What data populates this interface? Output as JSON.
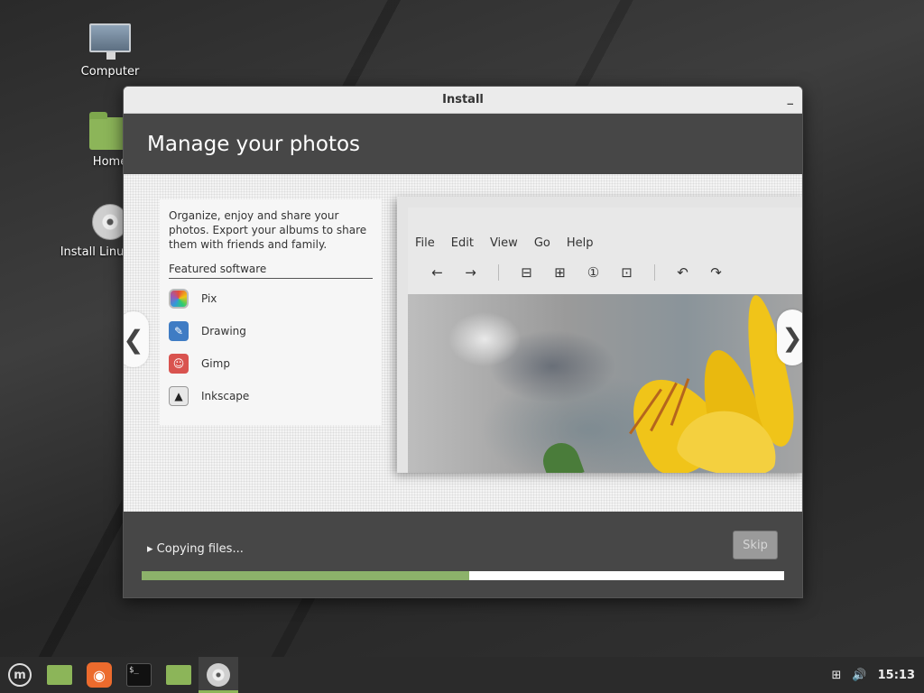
{
  "desktop": {
    "icons": [
      {
        "label": "Computer",
        "icon": "computer-icon"
      },
      {
        "label": "Home",
        "icon": "home-folder-icon"
      },
      {
        "label": "Install Linux Mint",
        "icon": "install-disc-icon"
      }
    ]
  },
  "window": {
    "title": "Install",
    "minimize_glyph": "_",
    "header": "Manage your photos",
    "description": "Organize, enjoy and share your photos. Export your albums to share them with friends and family.",
    "featured_title": "Featured software",
    "apps": [
      {
        "name": "Pix",
        "icon": "pix-icon"
      },
      {
        "name": "Drawing",
        "icon": "drawing-icon"
      },
      {
        "name": "Gimp",
        "icon": "gimp-icon"
      },
      {
        "name": "Inkscape",
        "icon": "inkscape-icon"
      }
    ],
    "nav_prev": "❮",
    "nav_next": "❯",
    "preview": {
      "menu": [
        "File",
        "Edit",
        "View",
        "Go",
        "Help"
      ],
      "toolbar": [
        "←",
        "→",
        "⊟",
        "⊞",
        "①",
        "⊡",
        "↶",
        "↷"
      ]
    },
    "status": "▸ Copying files...",
    "skip_label": "Skip",
    "progress": 0.51
  },
  "taskbar": {
    "clock": "15:13",
    "items": [
      "menu-icon",
      "files-icon",
      "firefox-icon",
      "terminal-icon",
      "folder-icon",
      "installer-icon"
    ],
    "tray": [
      "network-icon",
      "volume-icon"
    ]
  }
}
